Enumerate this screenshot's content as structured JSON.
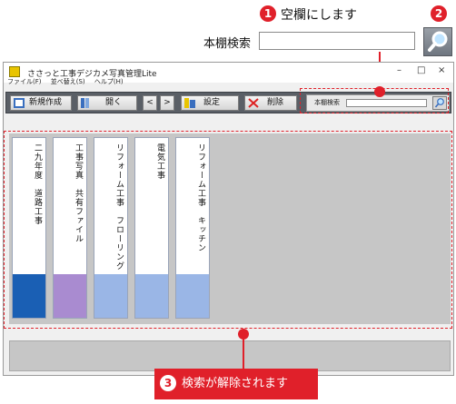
{
  "callouts": {
    "one": {
      "number": "1",
      "text": "空欄にします"
    },
    "two": {
      "number": "2"
    },
    "three": {
      "number": "3",
      "text": "検索が解除されます"
    }
  },
  "zoom": {
    "label": "本棚検索",
    "input_value": "",
    "button_icon": "magnifier-icon"
  },
  "window": {
    "title": "ささっと工事デジカメ写真管理Lite",
    "controls": {
      "minimize": "–",
      "maximize": "□",
      "close": "×"
    }
  },
  "menu": [
    "ファイル(F)",
    "並べ替え(S)",
    "ヘルプ(H)"
  ],
  "toolbar": {
    "new_label": "新規作成",
    "open_label": "開く",
    "prev_label": "<",
    "next_label": ">",
    "settings_label": "設定",
    "delete_label": "削除",
    "search_label": "本棚検索",
    "search_value": "",
    "search_icon": "magnifier-icon"
  },
  "binders": [
    {
      "title": "二九年度　道路工事",
      "color": "#1a5fb4"
    },
    {
      "title": "工事写真　共有ファイル",
      "color": "#a98bd0"
    },
    {
      "title": "リフォーム工事　フローリング",
      "color": "#9ab6e6"
    },
    {
      "title": "電気工事",
      "color": "#9ab6e6"
    },
    {
      "title": "リフォーム工事　キッチン",
      "color": "#9ab6e6"
    }
  ],
  "colors": {
    "accent": "#e0202a",
    "toolbar": "#5a5f66",
    "shelf": "#c6c6c6"
  }
}
